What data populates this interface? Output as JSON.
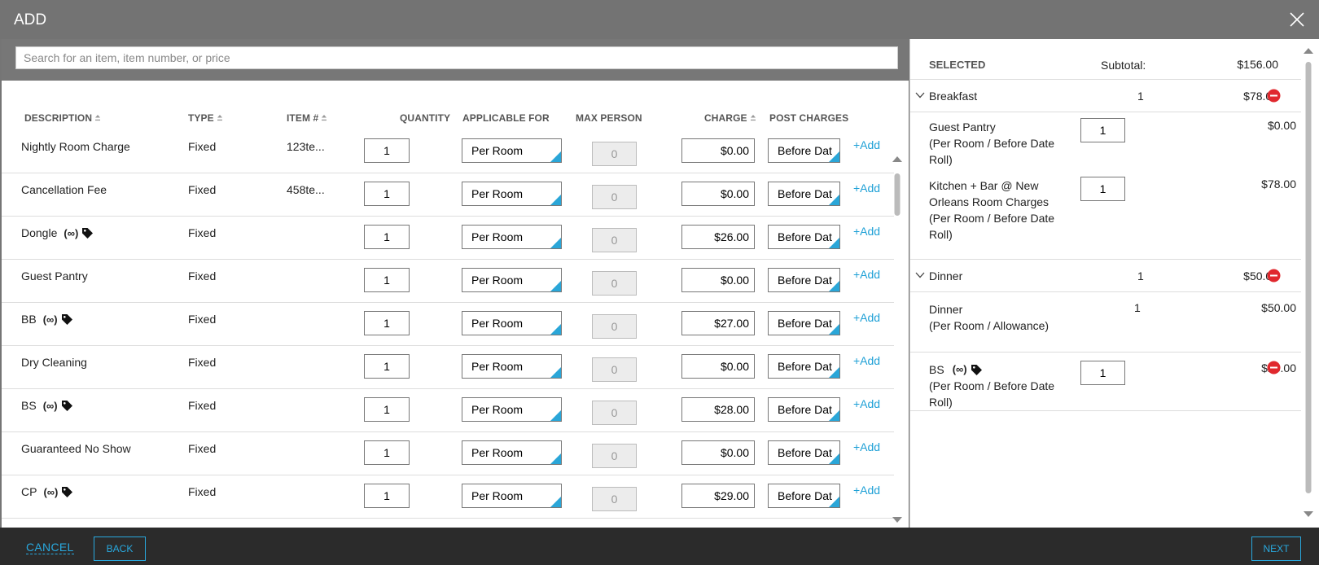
{
  "dialog": {
    "title": "ADD"
  },
  "search": {
    "placeholder": "Search for an item, item number, or price"
  },
  "columns": {
    "description": "DESCRIPTION",
    "type": "TYPE",
    "item_no": "ITEM #",
    "quantity": "QUANTITY",
    "applicable_for": "APPLICABLE FOR",
    "max_person": "MAX PERSON",
    "charge": "CHARGE",
    "post_charges": "POST CHARGES"
  },
  "rows": [
    {
      "description": "Nightly Room Charge",
      "infinite": "",
      "tag": false,
      "type": "Fixed",
      "item_no": "123te...",
      "quantity": "1",
      "applicable_for": "Per Room",
      "max_person": "0",
      "charge": "$0.00",
      "post_charges": "Before Dat",
      "add": "+Add"
    },
    {
      "description": "Cancellation Fee",
      "infinite": "",
      "tag": false,
      "type": "Fixed",
      "item_no": "458te...",
      "quantity": "1",
      "applicable_for": "Per Room",
      "max_person": "0",
      "charge": "$0.00",
      "post_charges": "Before Dat",
      "add": "+Add"
    },
    {
      "description": "Dongle",
      "infinite": "(∞)",
      "tag": true,
      "type": "Fixed",
      "item_no": "",
      "quantity": "1",
      "applicable_for": "Per Room",
      "max_person": "0",
      "charge": "$26.00",
      "post_charges": "Before Dat",
      "add": "+Add"
    },
    {
      "description": "Guest Pantry",
      "infinite": "",
      "tag": false,
      "type": "Fixed",
      "item_no": "",
      "quantity": "1",
      "applicable_for": "Per Room",
      "max_person": "0",
      "charge": "$0.00",
      "post_charges": "Before Dat",
      "add": "+Add"
    },
    {
      "description": "BB",
      "infinite": "(∞)",
      "tag": true,
      "type": "Fixed",
      "item_no": "",
      "quantity": "1",
      "applicable_for": "Per Room",
      "max_person": "0",
      "charge": "$27.00",
      "post_charges": "Before Dat",
      "add": "+Add"
    },
    {
      "description": "Dry Cleaning",
      "infinite": "",
      "tag": false,
      "type": "Fixed",
      "item_no": "",
      "quantity": "1",
      "applicable_for": "Per Room",
      "max_person": "0",
      "charge": "$0.00",
      "post_charges": "Before Dat",
      "add": "+Add"
    },
    {
      "description": "BS",
      "infinite": "(∞)",
      "tag": true,
      "type": "Fixed",
      "item_no": "",
      "quantity": "1",
      "applicable_for": "Per Room",
      "max_person": "0",
      "charge": "$28.00",
      "post_charges": "Before Dat",
      "add": "+Add"
    },
    {
      "description": "Guaranteed No Show",
      "infinite": "",
      "tag": false,
      "type": "Fixed",
      "item_no": "",
      "quantity": "1",
      "applicable_for": "Per Room",
      "max_person": "0",
      "charge": "$0.00",
      "post_charges": "Before Dat",
      "add": "+Add"
    },
    {
      "description": "CP",
      "infinite": "(∞)",
      "tag": true,
      "type": "Fixed",
      "item_no": "",
      "quantity": "1",
      "applicable_for": "Per Room",
      "max_person": "0",
      "charge": "$29.00",
      "post_charges": "Before Dat",
      "add": "+Add"
    }
  ],
  "selected": {
    "title": "SELECTED",
    "subtotal_label": "Subtotal:",
    "subtotal": "$156.00",
    "groups": [
      {
        "name": "Breakfast",
        "qty": "1",
        "amount": "$78.00",
        "items": [
          {
            "lines": [
              "Guest Pantry",
              "(Per Room / Before Date",
              "Roll)"
            ],
            "qty": "1",
            "amount": "$0.00"
          },
          {
            "lines": [
              "Kitchen + Bar @ New",
              "Orleans Room Charges",
              "(Per Room / Before Date",
              "Roll)"
            ],
            "qty": "1",
            "amount": "$78.00"
          }
        ]
      },
      {
        "name": "Dinner",
        "qty": "1",
        "amount": "$50.00",
        "items": [
          {
            "lines": [
              "Dinner",
              "(Per Room / Allowance)"
            ],
            "qty": "1",
            "amount": "$50.00"
          }
        ]
      }
    ],
    "standalone": {
      "name": "BS",
      "infinite": "(∞)",
      "line2": "(Per Room / Before Date",
      "line3": "Roll)",
      "qty": "1",
      "amount": "$28.00"
    }
  },
  "footer": {
    "cancel": "CANCEL",
    "back": "BACK",
    "next": "NEXT"
  },
  "colors": {
    "accent": "#29a9df",
    "remove": "#e0282e",
    "header_bg": "#737373",
    "footer_bg": "#2b2b2b"
  },
  "icons": [
    "close-icon",
    "sort-icon",
    "tag-icon",
    "chevron-down-icon",
    "remove-icon",
    "scroll-up-icon",
    "scroll-down-icon"
  ]
}
